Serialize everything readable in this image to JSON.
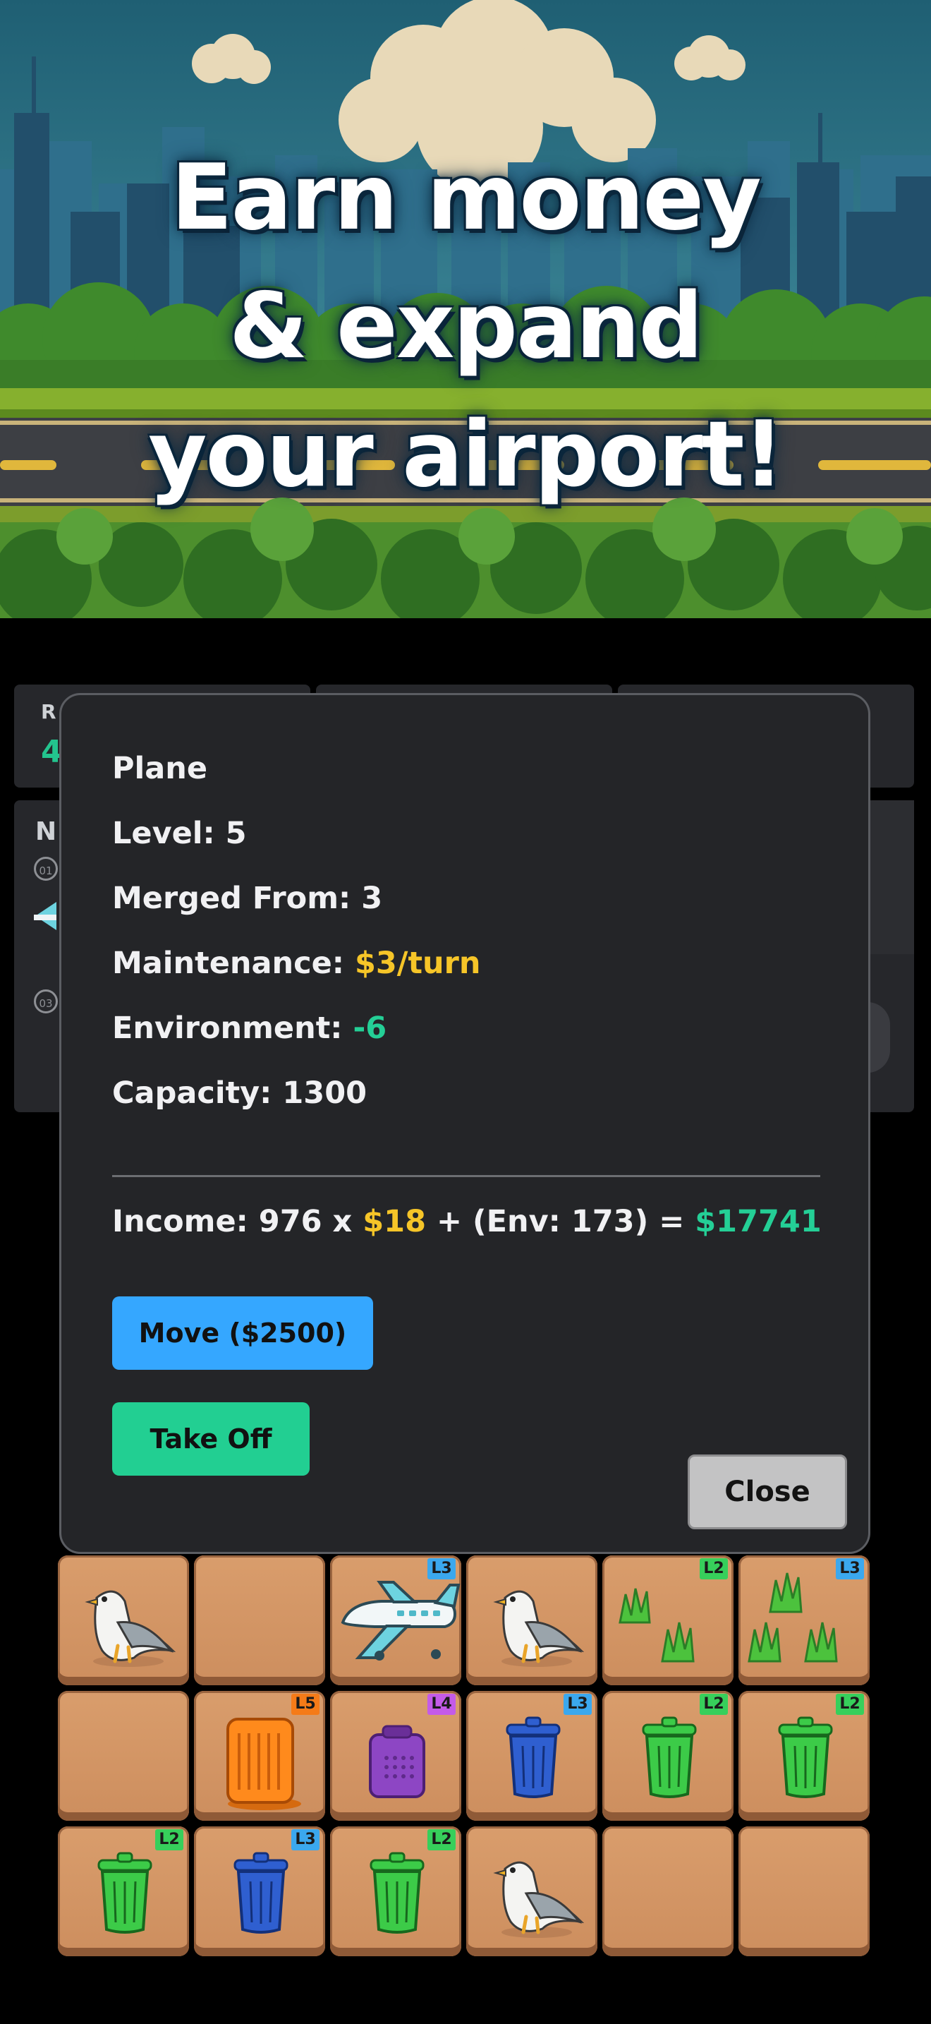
{
  "hero": {
    "title_lines": [
      "Earn money",
      "& expand",
      "your airport!"
    ]
  },
  "background": {
    "stat_prefix": "R",
    "stat_value": "4",
    "card_prefix": "N",
    "slot_labels": [
      "01",
      "03"
    ]
  },
  "modal": {
    "name": "Plane",
    "level_label": "Level: 5",
    "merged_label": "Merged From: 3",
    "maintenance_label": "Maintenance:",
    "maintenance_value": "$3/turn",
    "environment_label": "Environment:",
    "environment_value": "-6",
    "capacity_label": "Capacity: 1300",
    "income_prefix": "Income: 976 x",
    "income_rate": "$18",
    "income_env": "+ (Env: 173) =",
    "income_total": "$17741",
    "move_label": "Move ($2500)",
    "takeoff_label": "Take Off",
    "close_label": "Close"
  },
  "grid": {
    "rows": [
      [
        {
          "item": "seagull-icon",
          "level": ""
        },
        {
          "item": "empty",
          "level": ""
        },
        {
          "item": "plane-icon",
          "level": "L3",
          "badge_color": "#3ba8ee"
        },
        {
          "item": "seagull-icon",
          "level": ""
        },
        {
          "item": "grass-icon",
          "level": "L2",
          "badge_color": "#37cf5b"
        },
        {
          "item": "grass-icon",
          "level": "L3",
          "badge_color": "#3ba8ee"
        }
      ],
      [
        {
          "item": "empty",
          "level": ""
        },
        {
          "item": "orange-air-purifier-icon",
          "level": "L5",
          "badge_color": "#f57b18"
        },
        {
          "item": "purple-air-purifier-icon",
          "level": "L4",
          "badge_color": "#c45be8"
        },
        {
          "item": "blue-trash-can-icon",
          "level": "L3",
          "badge_color": "#3ba8ee"
        },
        {
          "item": "green-trash-can-icon",
          "level": "L2",
          "badge_color": "#37cf5b"
        },
        {
          "item": "green-trash-can-icon",
          "level": "L2",
          "badge_color": "#37cf5b"
        }
      ],
      [
        {
          "item": "green-trash-can-icon",
          "level": "L2",
          "badge_color": "#37cf5b"
        },
        {
          "item": "blue-trash-can-icon",
          "level": "L3",
          "badge_color": "#3ba8ee"
        },
        {
          "item": "green-trash-can-icon",
          "level": "L2",
          "badge_color": "#37cf5b"
        },
        {
          "item": "seagull-icon",
          "level": ""
        },
        {
          "item": "empty",
          "level": ""
        },
        {
          "item": "empty",
          "level": ""
        }
      ]
    ]
  },
  "colors": {
    "accent_yellow": "#f6c528",
    "accent_green": "#24cf96",
    "move_button": "#35a7ff",
    "takeoff_button": "#22cf92",
    "modal_bg": "#242528"
  }
}
